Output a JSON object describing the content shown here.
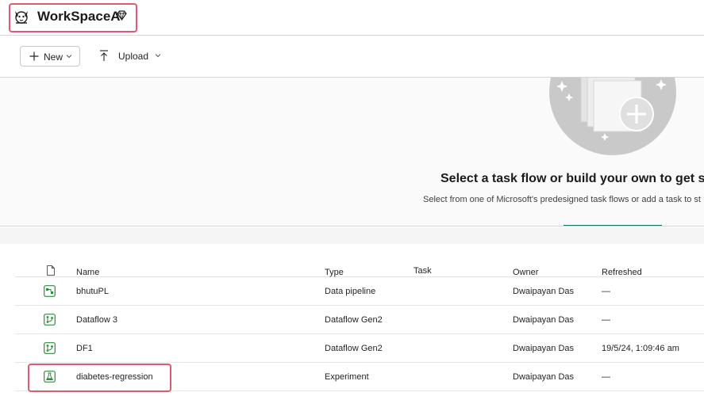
{
  "header": {
    "workspace_name": "WorkSpaceA",
    "avatar_icon": "dog-avatar-icon",
    "premium_icon": "diamond-icon"
  },
  "toolbar": {
    "new_label": "New",
    "upload_label": "Upload"
  },
  "taskflow": {
    "title": "Select a task flow or build your own to get sta",
    "subtitle": "Select from one of Microsoft's predesigned task flows or add a task to st"
  },
  "table": {
    "headers": {
      "name": "Name",
      "type": "Type",
      "task": "Task",
      "owner": "Owner",
      "refreshed": "Refreshed"
    },
    "rows": [
      {
        "name": "bhutuPL",
        "type": "Data pipeline",
        "owner": "Dwaipayan Das",
        "refreshed": "—",
        "icon": "pipeline-icon"
      },
      {
        "name": "Dataflow 3",
        "type": "Dataflow Gen2",
        "owner": "Dwaipayan Das",
        "refreshed": "—",
        "icon": "dataflow-icon"
      },
      {
        "name": "DF1",
        "type": "Dataflow Gen2",
        "owner": "Dwaipayan Das",
        "refreshed": "19/5/24, 1:09:46 am",
        "icon": "dataflow-icon"
      },
      {
        "name": "diabetes-regression",
        "type": "Experiment",
        "owner": "Dwaipayan Das",
        "refreshed": "—",
        "icon": "experiment-icon"
      }
    ]
  },
  "colors": {
    "highlight": "#e05a6e",
    "accent": "#117865",
    "icon_green": "#2e8b3e"
  }
}
